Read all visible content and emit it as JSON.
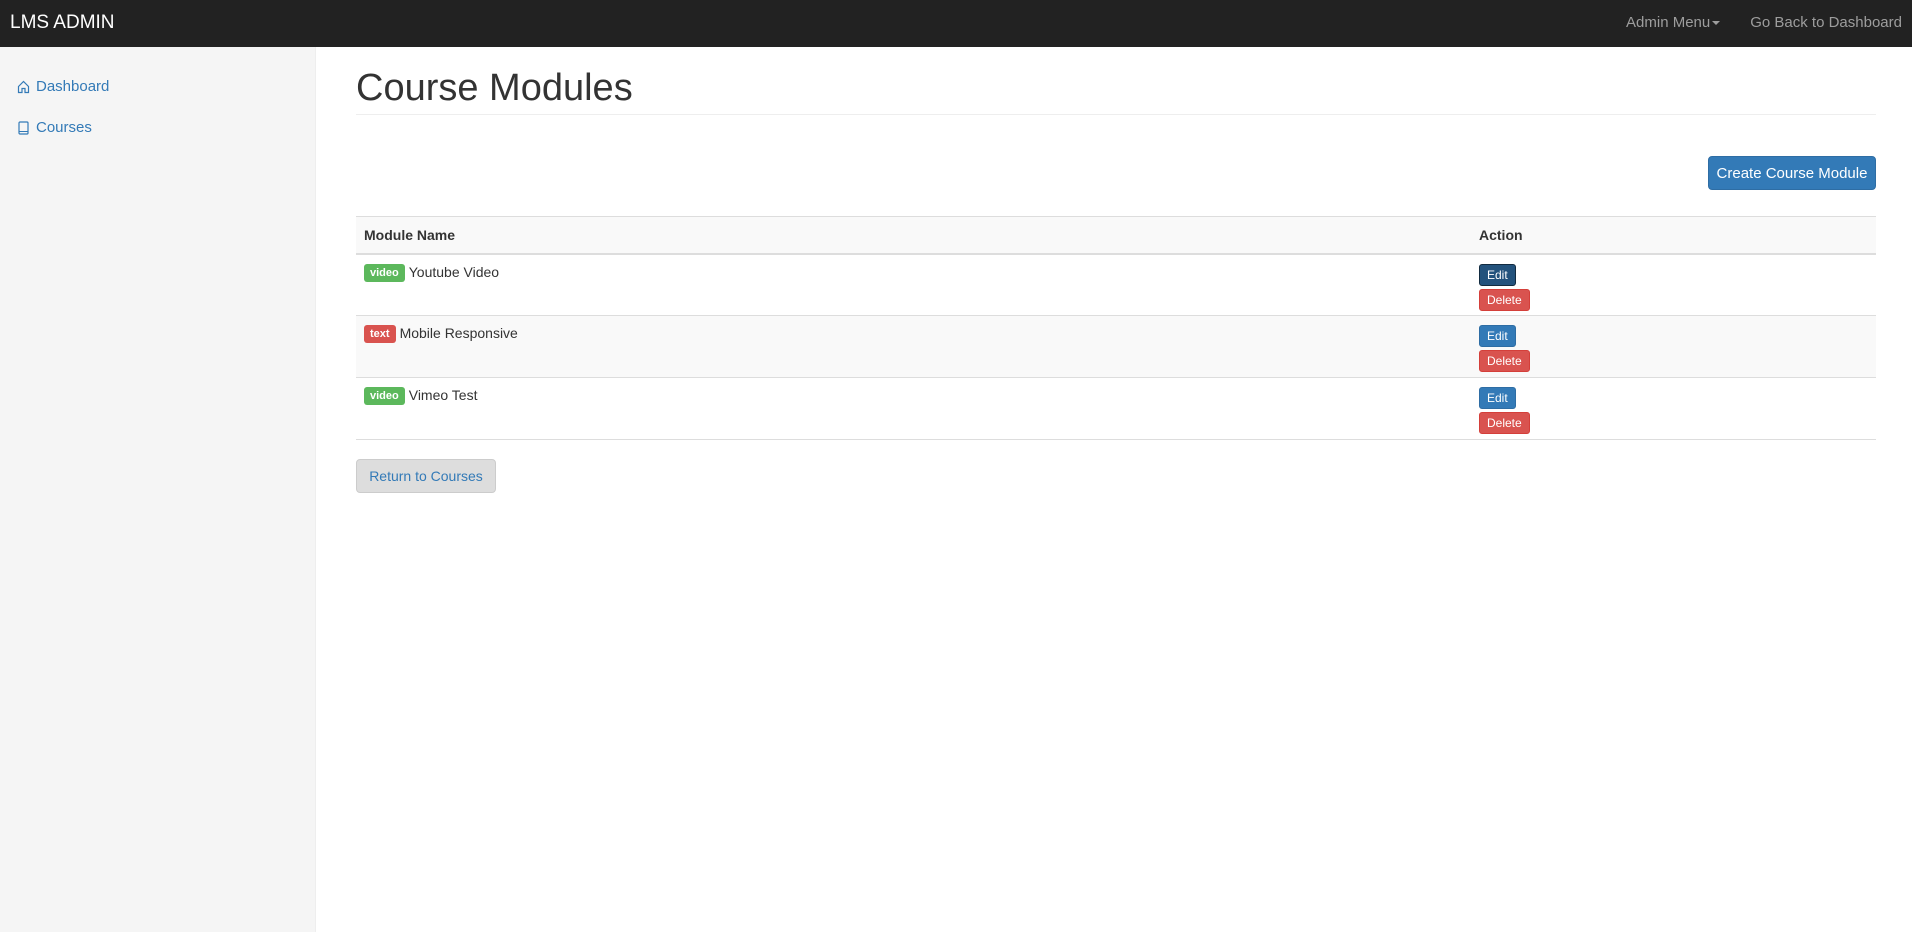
{
  "navbar": {
    "brand": "LMS ADMIN",
    "admin_menu": "Admin Menu",
    "back_link": "Go Back to Dashboard"
  },
  "sidebar": {
    "items": [
      {
        "label": "Dashboard",
        "icon": "home-icon"
      },
      {
        "label": "Courses",
        "icon": "book-icon"
      }
    ]
  },
  "main": {
    "title": "Course Modules",
    "create_button": "Create Course Module",
    "return_button": "Return to Courses"
  },
  "table": {
    "headers": [
      "Module Name",
      "Action"
    ],
    "rows": [
      {
        "type": "video",
        "type_color": "#5cb85c",
        "name": "Youtube Video",
        "edit": "Edit",
        "delete": "Delete"
      },
      {
        "type": "text",
        "type_color": "#d9534f",
        "name": "Mobile Responsive",
        "edit": "Edit",
        "delete": "Delete"
      },
      {
        "type": "video",
        "type_color": "#5cb85c",
        "name": "Vimeo Test",
        "edit": "Edit",
        "delete": "Delete"
      }
    ]
  },
  "colors": {
    "navbar_bg": "#222222",
    "primary": "#337ab7",
    "danger": "#d9534f",
    "success": "#5cb85c"
  }
}
